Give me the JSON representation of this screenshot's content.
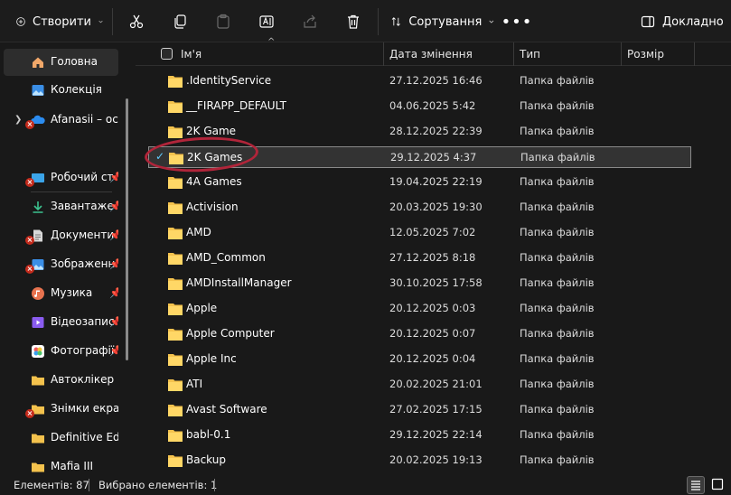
{
  "toolbar": {
    "create_label": "Створити",
    "sort_label": "Сортування",
    "more_label": "•••",
    "details_label": "Докладно",
    "icons": [
      "cut-icon",
      "copy-icon",
      "paste-icon",
      "rename-icon",
      "share-icon",
      "delete-icon"
    ]
  },
  "sidebar": {
    "items": [
      {
        "label": "Головна",
        "icon": "home-icon"
      },
      {
        "label": "Колекція",
        "icon": "gallery-icon"
      },
      {
        "label": "Afanasii – осо",
        "icon": "onedrive-icon"
      },
      {
        "label": "Робочий ст",
        "icon": "desktop-icon"
      },
      {
        "label": "Завантаже",
        "icon": "download-icon"
      },
      {
        "label": "Документи",
        "icon": "document-icon"
      },
      {
        "label": "Зображенн",
        "icon": "pictures-icon"
      },
      {
        "label": "Музика",
        "icon": "music-icon"
      },
      {
        "label": "Відеозапис",
        "icon": "video-icon"
      },
      {
        "label": "Фотографії",
        "icon": "photos-icon"
      },
      {
        "label": "Автоклікер",
        "icon": "folder-icon"
      },
      {
        "label": "Знімки екрана",
        "icon": "folder-icon"
      },
      {
        "label": "Definitive Editi",
        "icon": "folder-icon"
      },
      {
        "label": "Mafia III",
        "icon": "folder-icon"
      }
    ]
  },
  "columns": {
    "name": "Ім'я",
    "date": "Дата змінення",
    "type": "Тип",
    "size": "Розмір"
  },
  "files": [
    {
      "name": ".IdentityService",
      "date": "27.12.2025 16:46",
      "type": "Папка файлів"
    },
    {
      "name": "__FIRAPP_DEFAULT",
      "date": "04.06.2025 5:42",
      "type": "Папка файлів"
    },
    {
      "name": "2K Game",
      "date": "28.12.2025 22:39",
      "type": "Папка файлів"
    },
    {
      "name": "2K Games",
      "date": "29.12.2025 4:37",
      "type": "Папка файлів"
    },
    {
      "name": "4A Games",
      "date": "19.04.2025 22:19",
      "type": "Папка файлів"
    },
    {
      "name": "Activision",
      "date": "20.03.2025 19:30",
      "type": "Папка файлів"
    },
    {
      "name": "AMD",
      "date": "12.05.2025 7:02",
      "type": "Папка файлів"
    },
    {
      "name": "AMD_Common",
      "date": "27.12.2025 8:18",
      "type": "Папка файлів"
    },
    {
      "name": "AMDInstallManager",
      "date": "30.10.2025 17:58",
      "type": "Папка файлів"
    },
    {
      "name": "Apple",
      "date": "20.12.2025 0:03",
      "type": "Папка файлів"
    },
    {
      "name": "Apple Computer",
      "date": "20.12.2025 0:07",
      "type": "Папка файлів"
    },
    {
      "name": "Apple Inc",
      "date": "20.12.2025 0:04",
      "type": "Папка файлів"
    },
    {
      "name": "ATI",
      "date": "20.02.2025 21:01",
      "type": "Папка файлів"
    },
    {
      "name": "Avast Software",
      "date": "27.02.2025 17:15",
      "type": "Папка файлів"
    },
    {
      "name": "babl-0.1",
      "date": "29.12.2025 22:14",
      "type": "Папка файлів"
    },
    {
      "name": "Backup",
      "date": "20.02.2025 19:13",
      "type": "Папка файлів"
    }
  ],
  "status": {
    "count": "Елементів: 87",
    "selected": "Вибрано елементів: 1"
  },
  "colors": {
    "background": "#191919",
    "folder": "#f4c24d",
    "accent": "#60cdff",
    "annotation": "#b1253a",
    "error": "#c42b1c"
  }
}
